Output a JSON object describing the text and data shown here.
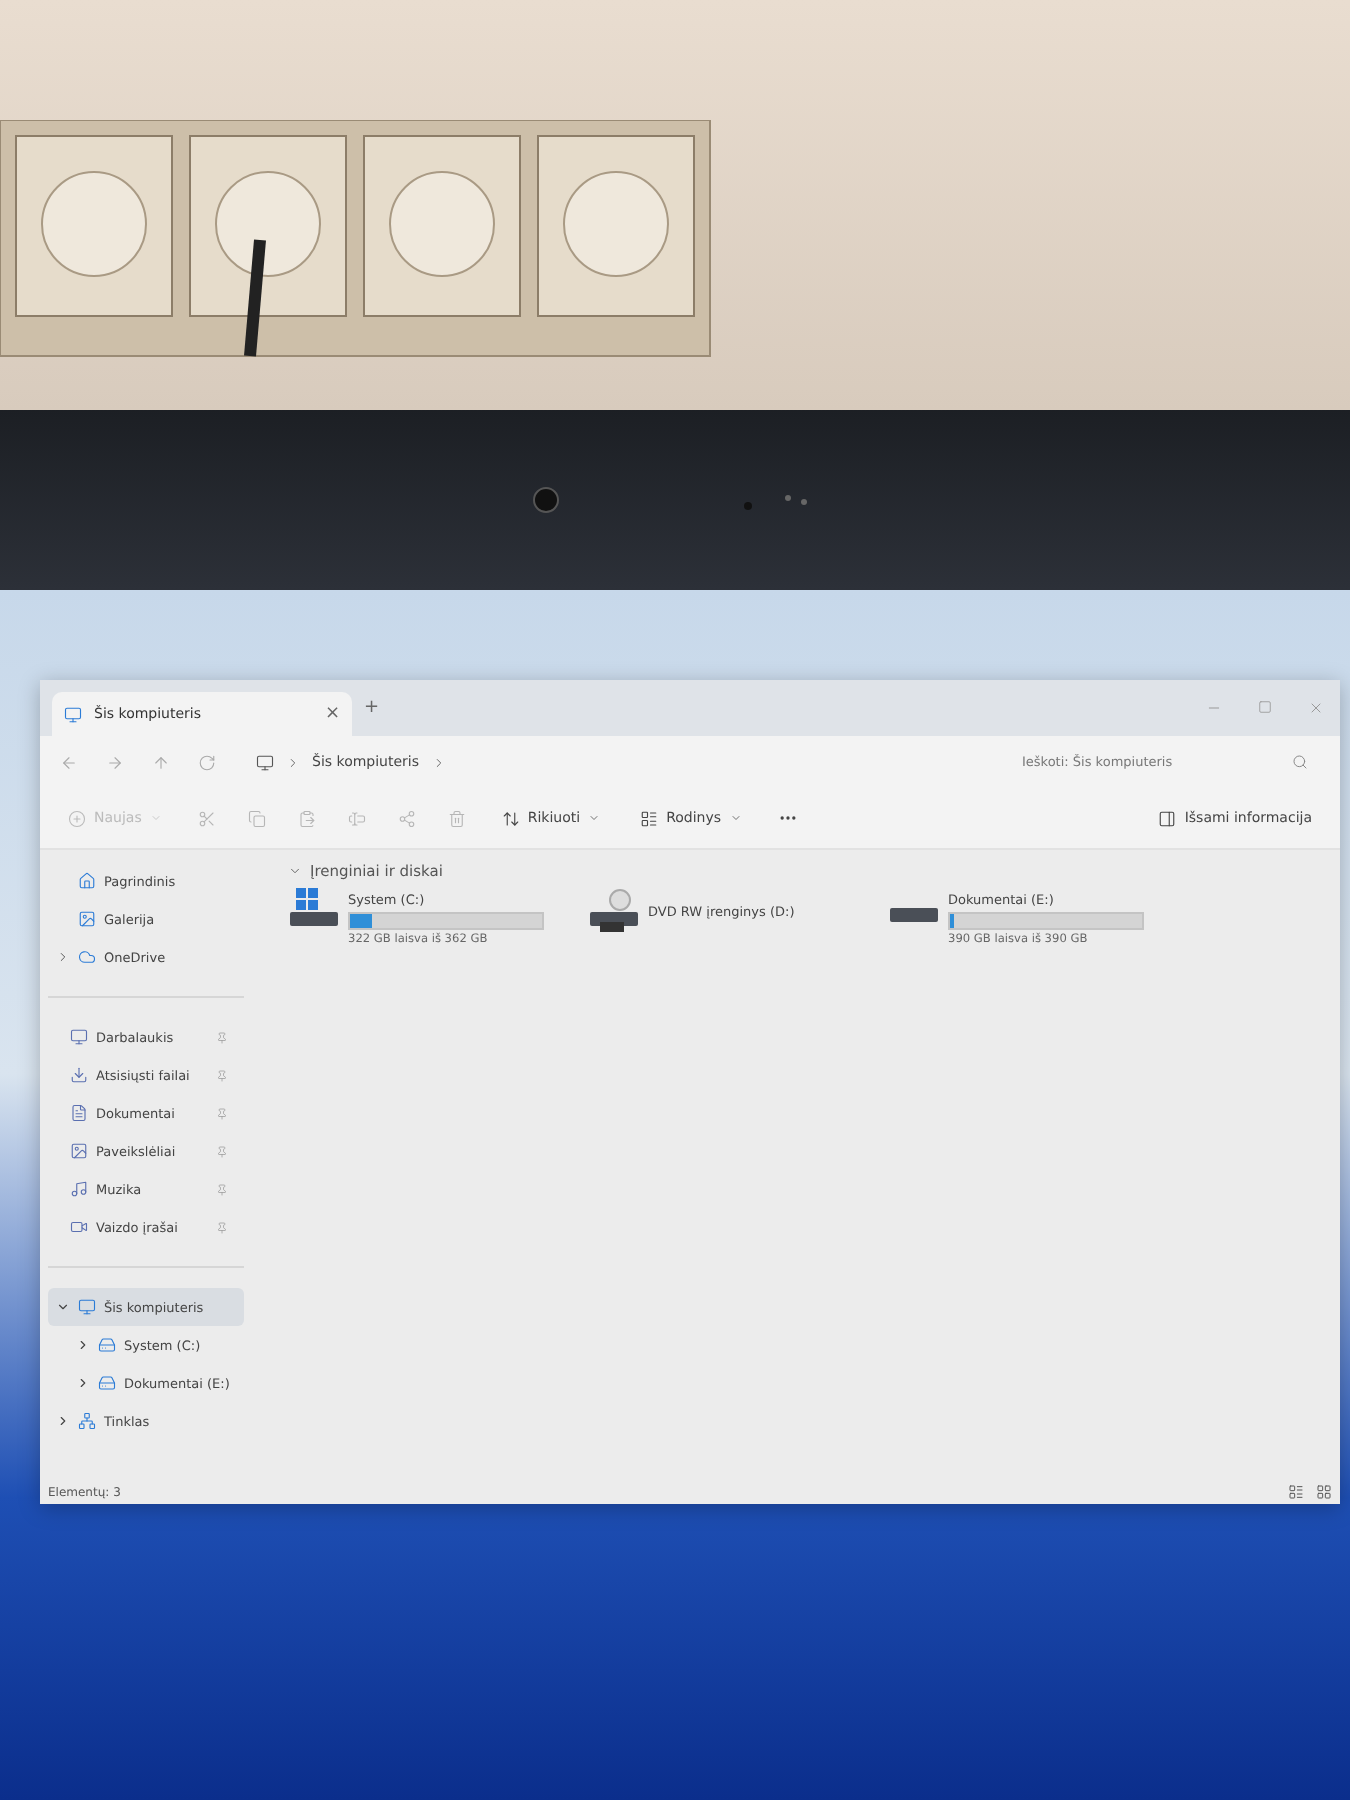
{
  "window": {
    "tabs": [
      {
        "label": "Šis kompiuteris",
        "selected": true,
        "close": "×"
      }
    ],
    "new_tab": "+"
  },
  "address_bar": {
    "path": [
      "Šis kompiuteris"
    ],
    "search": {
      "placeholder": "Ieškoti: Šis kompiuteris"
    }
  },
  "toolbar": {
    "new": {
      "label": "Naujas",
      "disabled": true
    },
    "sort": "Rikiuoti",
    "view": "Rodinys",
    "details": "Išsami informacija"
  },
  "sidebar": {
    "top": [
      {
        "label": "Pagrindinis",
        "expandable": false
      },
      {
        "label": "Galerija",
        "expandable": false
      },
      {
        "label": "OneDrive",
        "expandable": true
      }
    ],
    "quick_access": [
      {
        "label": "Darbalaukis",
        "pinned": true
      },
      {
        "label": "Atsisiųsti failai",
        "pinned": true
      },
      {
        "label": "Dokumentai",
        "pinned": true
      },
      {
        "label": "Paveikslėliai",
        "pinned": true
      },
      {
        "label": "Muzika",
        "pinned": true
      },
      {
        "label": "Vaizdo įrašai",
        "pinned": true
      }
    ],
    "tree": [
      {
        "label": "Šis kompiuteris",
        "selected": true,
        "expanded": true,
        "children": [
          {
            "label": "System (C:)",
            "selected": false,
            "expanded": false
          },
          {
            "label": "Dokumentai (E:)",
            "selected": false,
            "expanded": false
          }
        ]
      },
      {
        "label": "Tinklas",
        "selected": false,
        "expanded": false
      }
    ]
  },
  "content": {
    "group": {
      "label": "Įrenginiai ir diskai",
      "expanded": true
    },
    "drives": [
      {
        "kind": "disk",
        "system": true,
        "name": "System (C:)",
        "level": 0.11,
        "reading": "322 GB laisva iš 362 GB"
      },
      {
        "kind": "optical",
        "name": "DVD RW įrenginys (D:)"
      },
      {
        "kind": "disk",
        "system": false,
        "name": "Dokumentai (E:)",
        "level": 0.02,
        "reading": "390 GB laisva iš 390 GB"
      }
    ]
  },
  "status_bar": {
    "count": "Elementų: 3"
  }
}
